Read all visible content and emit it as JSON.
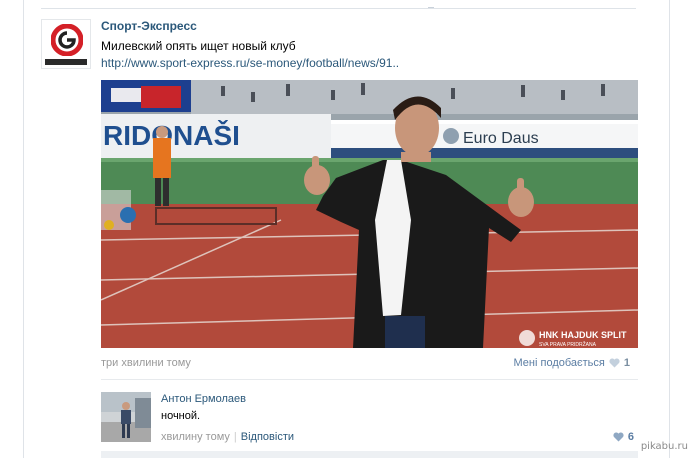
{
  "post": {
    "author": "Спорт-Экспресс",
    "text": "Милевский опять ищет новый клуб",
    "link": "http://www.sport-express.ru/se-money/football/news/91..",
    "time": "три хвилини тому",
    "like_label": "Мені подобається",
    "like_count": "1",
    "avatar_icon": "sport-express-logo-icon",
    "photo": {
      "banner_left": "RIDONAŠI",
      "banner_right": "Euro Daus",
      "club_label": "HNK HAJDUK SPLIT",
      "club_motto": "SVA PRAVA PRIDRŽANA"
    }
  },
  "comment": {
    "author": "Антон Ермолаев",
    "text": "ночной.",
    "time": "хвилину тому",
    "reply": "Відповісти",
    "like_count": "6"
  },
  "watermark": "pikabu.ru",
  "colors": {
    "link": "#2b587a",
    "meta": "#999999",
    "heart": "#8fa8c3",
    "logo_red": "#d42027"
  }
}
